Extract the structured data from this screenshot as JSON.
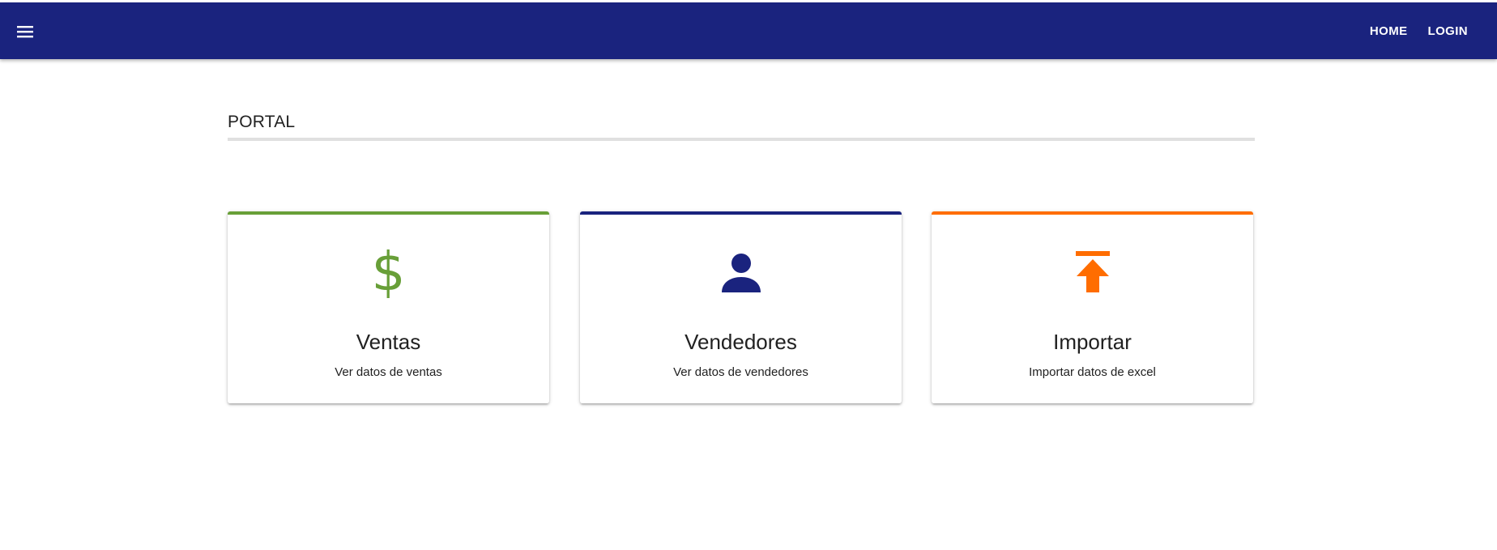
{
  "appbar": {
    "menu_icon": "menu-icon",
    "nav": [
      {
        "label": "HOME"
      },
      {
        "label": "LOGIN"
      }
    ]
  },
  "section": {
    "title": "PORTAL"
  },
  "cards": [
    {
      "title": "Ventas",
      "subtitle": "Ver datos de ventas",
      "icon": "dollar-icon",
      "icon_glyph": "$",
      "accent": "#689f38"
    },
    {
      "title": "Vendedores",
      "subtitle": "Ver datos de vendedores",
      "icon": "person-icon",
      "accent": "#1a237e"
    },
    {
      "title": "Importar",
      "subtitle": "Importar datos de excel",
      "icon": "upload-icon",
      "accent": "#ff6d00"
    }
  ],
  "colors": {
    "appbar": "#1a237e",
    "rule": "#e0e0e0"
  }
}
